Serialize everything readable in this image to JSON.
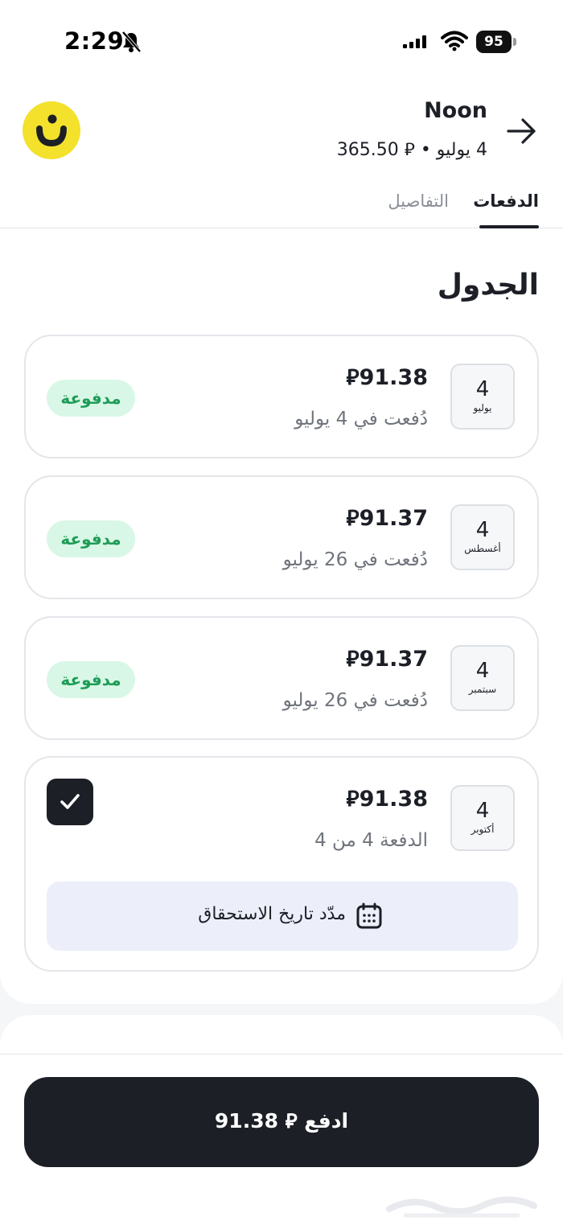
{
  "status_bar": {
    "time": "2:29",
    "battery": "95"
  },
  "header": {
    "merchant_name": "Noon",
    "meta": "4 يوليو • ⃁ 365.50",
    "logo_letter": "ن"
  },
  "tabs": [
    {
      "label": "الدفعات",
      "active": true
    },
    {
      "label": "التفاصيل",
      "active": false
    }
  ],
  "section_title": "الجدول",
  "installments": [
    {
      "day": "4",
      "month": "يوليو",
      "amount": "⃁91.38",
      "subtext": "دُفعت في 4 يوليو",
      "badge": "مدفوعة"
    },
    {
      "day": "4",
      "month": "أغسطس",
      "amount": "⃁91.37",
      "subtext": "دُفعت في 26 يوليو",
      "badge": "مدفوعة"
    },
    {
      "day": "4",
      "month": "سبتمبر",
      "amount": "⃁91.37",
      "subtext": "دُفعت في 26 يوليو",
      "badge": "مدفوعة"
    },
    {
      "day": "4",
      "month": "أكتوبر",
      "amount": "⃁91.38",
      "subtext": "الدفعة 4 من 4",
      "checked": true
    }
  ],
  "extend_due_date_label": "مدّد تاريخ الاستحقاق",
  "pay_button_label": "ادفع ⃁ 91.38",
  "colors": {
    "logo_yellow": "#f3e12b",
    "dark": "#1c1f26",
    "paid_badge_bg": "#d9f7e6",
    "paid_badge_text": "#1e9c57",
    "extend_bg": "#eceffa"
  }
}
